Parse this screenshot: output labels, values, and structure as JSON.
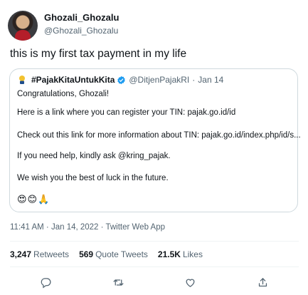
{
  "author": {
    "name": "Ghozali_Ghozalu",
    "handle": "@Ghozali_Ghozalu"
  },
  "tweet": {
    "text": "this is my first tax payment in my life"
  },
  "quote": {
    "name": "#PajakKitaUntukKita",
    "handle": "@DitjenPajakRI",
    "separator": "·",
    "date": "Jan 14",
    "lines": [
      "Congratulations, Ghozali!",
      "Here is a link where you can register your TIN: pajak.go.id/id",
      "Check out this link for more information about TIN: pajak.go.id/index.php/id/s...",
      "If you need help, kindly ask @kring_pajak.",
      "We wish you the best of luck in the future."
    ],
    "emojis": "😍😊🙏"
  },
  "meta": {
    "time": "11:41 AM · Jan 14, 2022 · Twitter Web App"
  },
  "stats": {
    "retweets_count": "3,247",
    "retweets_label": "Retweets",
    "quotes_count": "569",
    "quotes_label": "Quote Tweets",
    "likes_count": "21.5K",
    "likes_label": "Likes"
  },
  "icons": {
    "reply": "reply-icon",
    "retweet": "retweet-icon",
    "like": "heart-icon",
    "share": "share-icon",
    "verified": "verified-badge-icon"
  },
  "colors": {
    "text": "#0f1419",
    "secondary": "#536471",
    "verified": "#1d9bf0",
    "border": "#cfd9de"
  }
}
